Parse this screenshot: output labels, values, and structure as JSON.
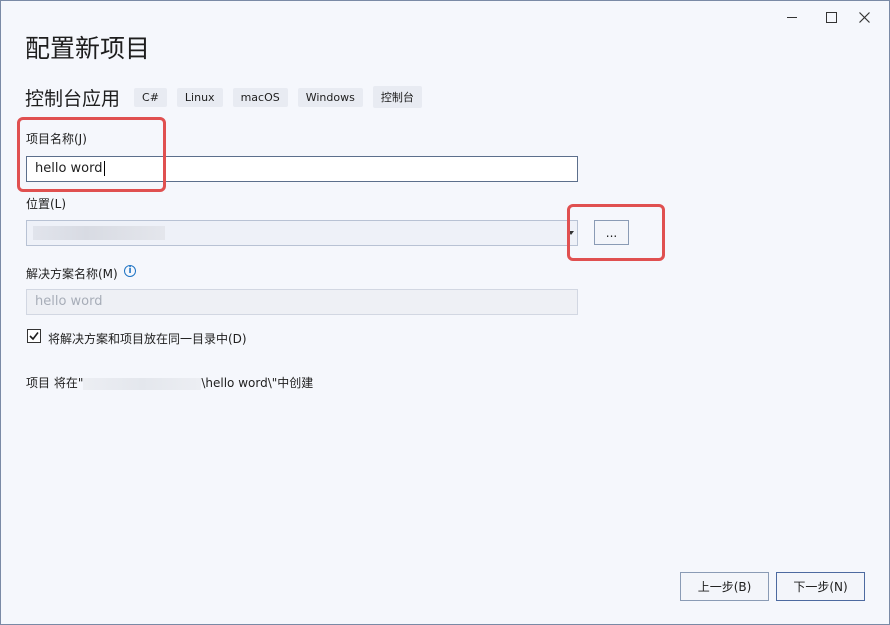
{
  "window": {
    "title": "配置新项目"
  },
  "template": {
    "name": "控制台应用",
    "tags": [
      "C#",
      "Linux",
      "macOS",
      "Windows",
      "控制台"
    ]
  },
  "form": {
    "project_name_label": "项目名称(J)",
    "project_name_value": "hello word",
    "location_label": "位置(L)",
    "browse_label": "...",
    "solution_name_label": "解决方案名称(M)",
    "solution_name_placeholder": "hello word",
    "same_dir_checkbox_label": "将解决方案和项目放在同一目录中(D)",
    "same_dir_checked": true
  },
  "summary": {
    "prefix": "项目 将在\"",
    "suffix": "\\hello word\\\"中创建"
  },
  "footer": {
    "back_label": "上一步(B)",
    "next_label": "下一步(N)"
  },
  "colors": {
    "highlight_box": "#e05050",
    "background": "#f5f7fc",
    "info_icon": "#1f74c4"
  }
}
